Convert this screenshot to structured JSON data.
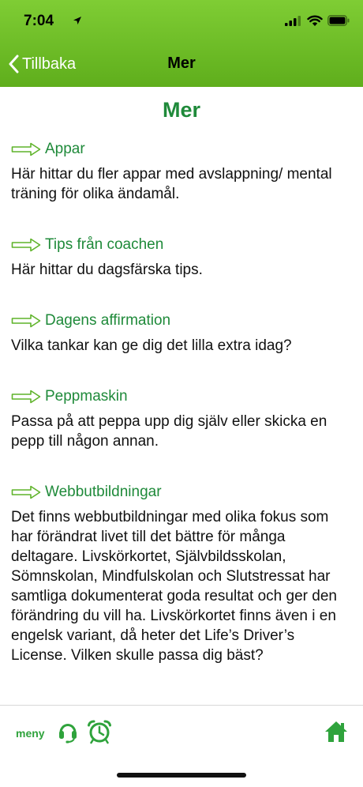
{
  "status_bar": {
    "time": "7:04"
  },
  "nav": {
    "back_label": "Tillbaka",
    "title": "Mer"
  },
  "page": {
    "title": "Mer",
    "sections": [
      {
        "title": "Appar",
        "body": "Här hittar du fler appar med avslappning/ mental träning för olika ändamål."
      },
      {
        "title": "Tips från coachen",
        "body": "Här hittar du dagsfärska tips."
      },
      {
        "title": "Dagens affirmation",
        "body": "Vilka tankar kan ge dig det lilla extra idag?"
      },
      {
        "title": "Peppmaskin",
        "body": "Passa på att peppa upp dig själv eller skicka en pepp till någon annan."
      },
      {
        "title": "Webbutbildningar",
        "body": "Det finns webbutbildningar med olika fokus som har förändrat livet till det bättre för många deltagare. Livskörkortet, Självbildsskolan, Sömnskolan, Mindfulskolan och Slutstressat har samtliga dokumenterat goda resultat och ger den förändring du vill ha. Livskörkortet finns även i en engelsk variant, då heter det Life’s Driver’s License. Vilken skulle passa dig bäst?"
      }
    ]
  },
  "tabbar": {
    "menu_label": "meny"
  },
  "colors": {
    "header_green": "#6cbd27",
    "accent_green": "#1f8a3a",
    "tab_green": "#2fa33c"
  },
  "icons": [
    "location-arrow-icon",
    "signal-icon",
    "wifi-icon",
    "battery-icon",
    "chevron-left-icon",
    "arrow-right-outline-icon",
    "headset-icon",
    "alarm-clock-icon",
    "home-icon"
  ]
}
